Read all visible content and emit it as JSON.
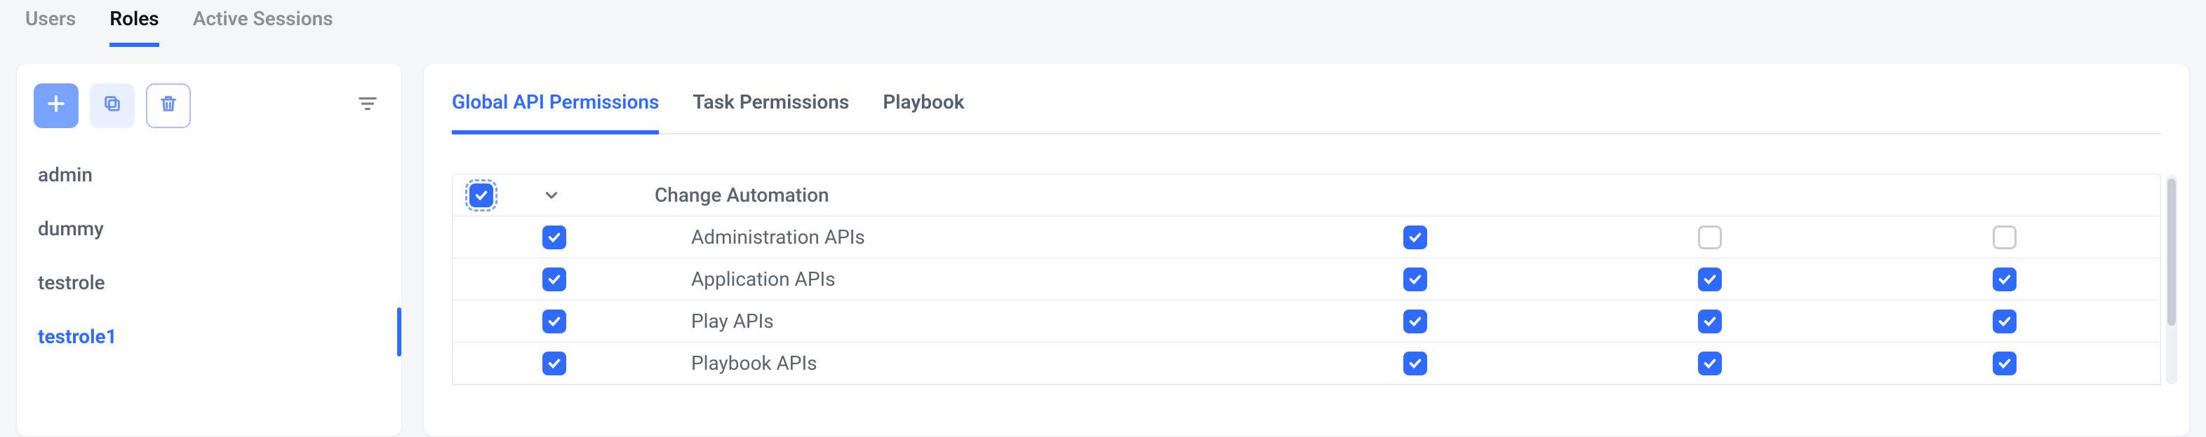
{
  "top_tabs": {
    "users": {
      "label": "Users",
      "active": false
    },
    "roles": {
      "label": "Roles",
      "active": true
    },
    "sess": {
      "label": "Active Sessions",
      "active": false
    }
  },
  "sidebar": {
    "roles": [
      {
        "name": "admin",
        "selected": false
      },
      {
        "name": "dummy",
        "selected": false
      },
      {
        "name": "testrole",
        "selected": false
      },
      {
        "name": "testrole1",
        "selected": true
      }
    ]
  },
  "sub_tabs": {
    "global": {
      "label": "Global API Permissions",
      "active": true
    },
    "task": {
      "label": "Task Permissions",
      "active": false
    },
    "playbook": {
      "label": "Playbook",
      "active": false
    }
  },
  "permissions": {
    "group": {
      "label": "Change Automation",
      "master_state": "indeterminate"
    },
    "rows": [
      {
        "label": "Administration APIs",
        "c0": true,
        "c1": true,
        "c2": false,
        "c3": false
      },
      {
        "label": "Application APIs",
        "c0": true,
        "c1": true,
        "c2": true,
        "c3": true
      },
      {
        "label": "Play APIs",
        "c0": true,
        "c1": true,
        "c2": true,
        "c3": true
      },
      {
        "label": "Playbook APIs",
        "c0": true,
        "c1": true,
        "c2": true,
        "c3": true
      }
    ]
  }
}
